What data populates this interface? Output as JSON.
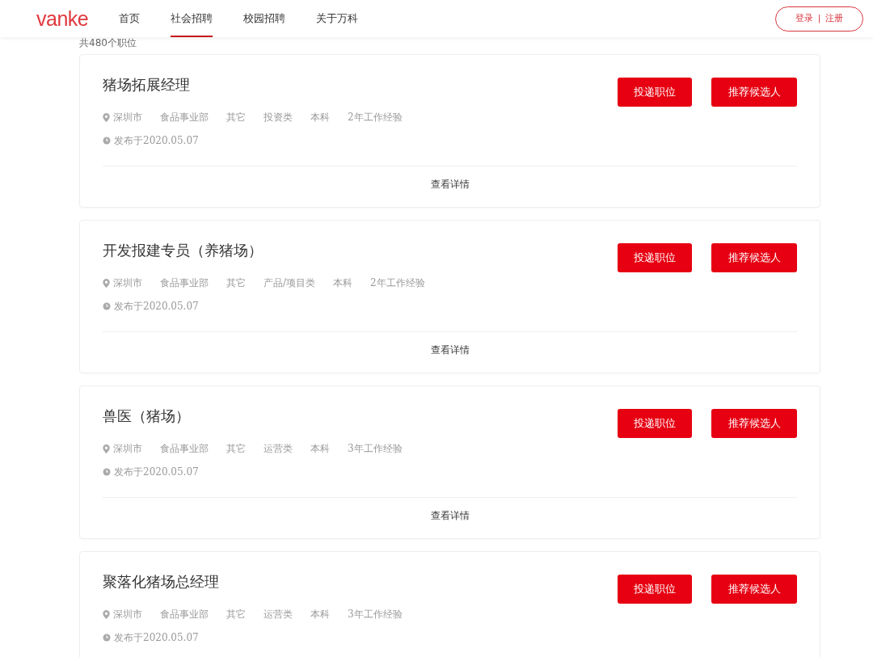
{
  "header": {
    "logo": "vanke",
    "nav": [
      {
        "label": "首页",
        "selected": false
      },
      {
        "label": "社会招聘",
        "selected": true
      },
      {
        "label": "校园招聘",
        "selected": false
      },
      {
        "label": "关于万科",
        "selected": false
      }
    ],
    "login": "登录",
    "separator": "|",
    "register": "注册"
  },
  "count": "共480个职位",
  "jobs": [
    {
      "title": "猪场拓展经理",
      "city": "深圳市",
      "tags": [
        "食品事业部",
        "其它",
        "投资类",
        "本科",
        "2年工作经验"
      ],
      "date": "发布于2020.05.07",
      "apply": "投递职位",
      "recommend": "推荐候选人",
      "details": "查看详情"
    },
    {
      "title": "开发报建专员（养猪场）",
      "city": "深圳市",
      "tags": [
        "食品事业部",
        "其它",
        "产品/项目类",
        "本科",
        "2年工作经验"
      ],
      "date": "发布于2020.05.07",
      "apply": "投递职位",
      "recommend": "推荐候选人",
      "details": "查看详情"
    },
    {
      "title": "兽医（猪场）",
      "city": "深圳市",
      "tags": [
        "食品事业部",
        "其它",
        "运营类",
        "本科",
        "3年工作经验"
      ],
      "date": "发布于2020.05.07",
      "apply": "投递职位",
      "recommend": "推荐候选人",
      "details": "查看详情"
    },
    {
      "title": "聚落化猪场总经理",
      "city": "深圳市",
      "tags": [
        "食品事业部",
        "其它",
        "运营类",
        "本科",
        "3年工作经验"
      ],
      "date": "发布于2020.05.07",
      "apply": "投递职位",
      "recommend": "推荐候选人"
    }
  ]
}
